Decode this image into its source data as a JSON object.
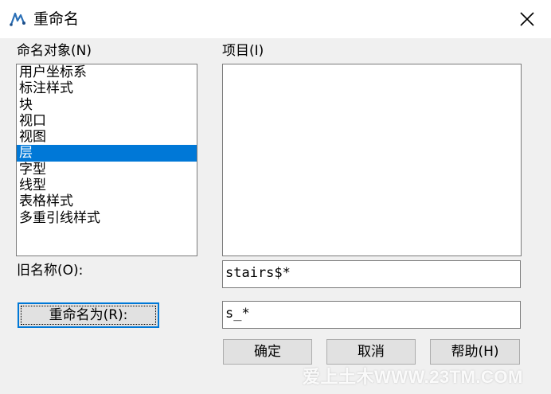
{
  "window": {
    "title": "重命名",
    "app_icon": "cad-app-icon",
    "close_icon": "close-icon"
  },
  "named_objects": {
    "label": "命名对象(N)",
    "items": [
      "用户坐标系",
      "标注样式",
      "块",
      "视口",
      "视图",
      "层",
      "字型",
      "线型",
      "表格样式",
      "多重引线样式"
    ],
    "selected_index": 5,
    "selected_value": "层"
  },
  "items_panel": {
    "label": "项目(I)"
  },
  "old_name": {
    "label": "旧名称(O):",
    "value": "stairs$*"
  },
  "rename_to": {
    "button_label": "重命名为(R):",
    "value": "s_*"
  },
  "buttons": {
    "ok": "确定",
    "cancel": "取消",
    "help": "帮助(H)"
  },
  "watermark": "爱上土木WWW.23TM.COM",
  "colors": {
    "selection": "#0078d7",
    "background": "#f0f0f0"
  }
}
